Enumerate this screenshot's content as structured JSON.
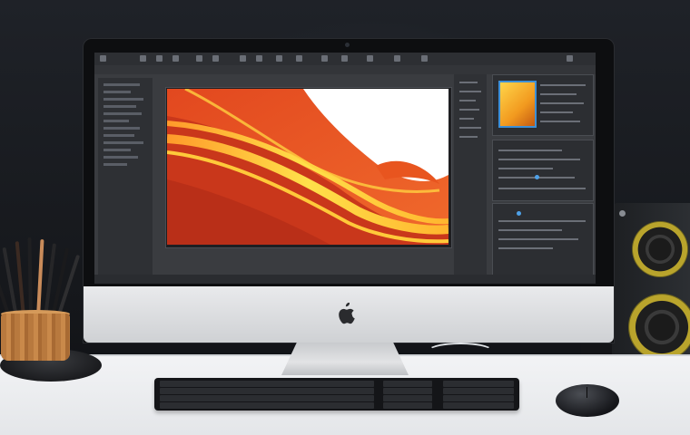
{
  "scene": {
    "description_items": [
      "monitor",
      "photo-editor-screen",
      "keyboard",
      "mouse",
      "speaker",
      "pencil-cup"
    ]
  },
  "colors": {
    "wall": "#1c1f24",
    "desk": "#eef0f2",
    "art_orange": "#f0602a",
    "art_yellow": "#ffd23a",
    "speaker_cone": "#b9a42c",
    "ui_accent": "#3d8fd6"
  },
  "icons": {
    "brand": "apple-logo-icon"
  }
}
